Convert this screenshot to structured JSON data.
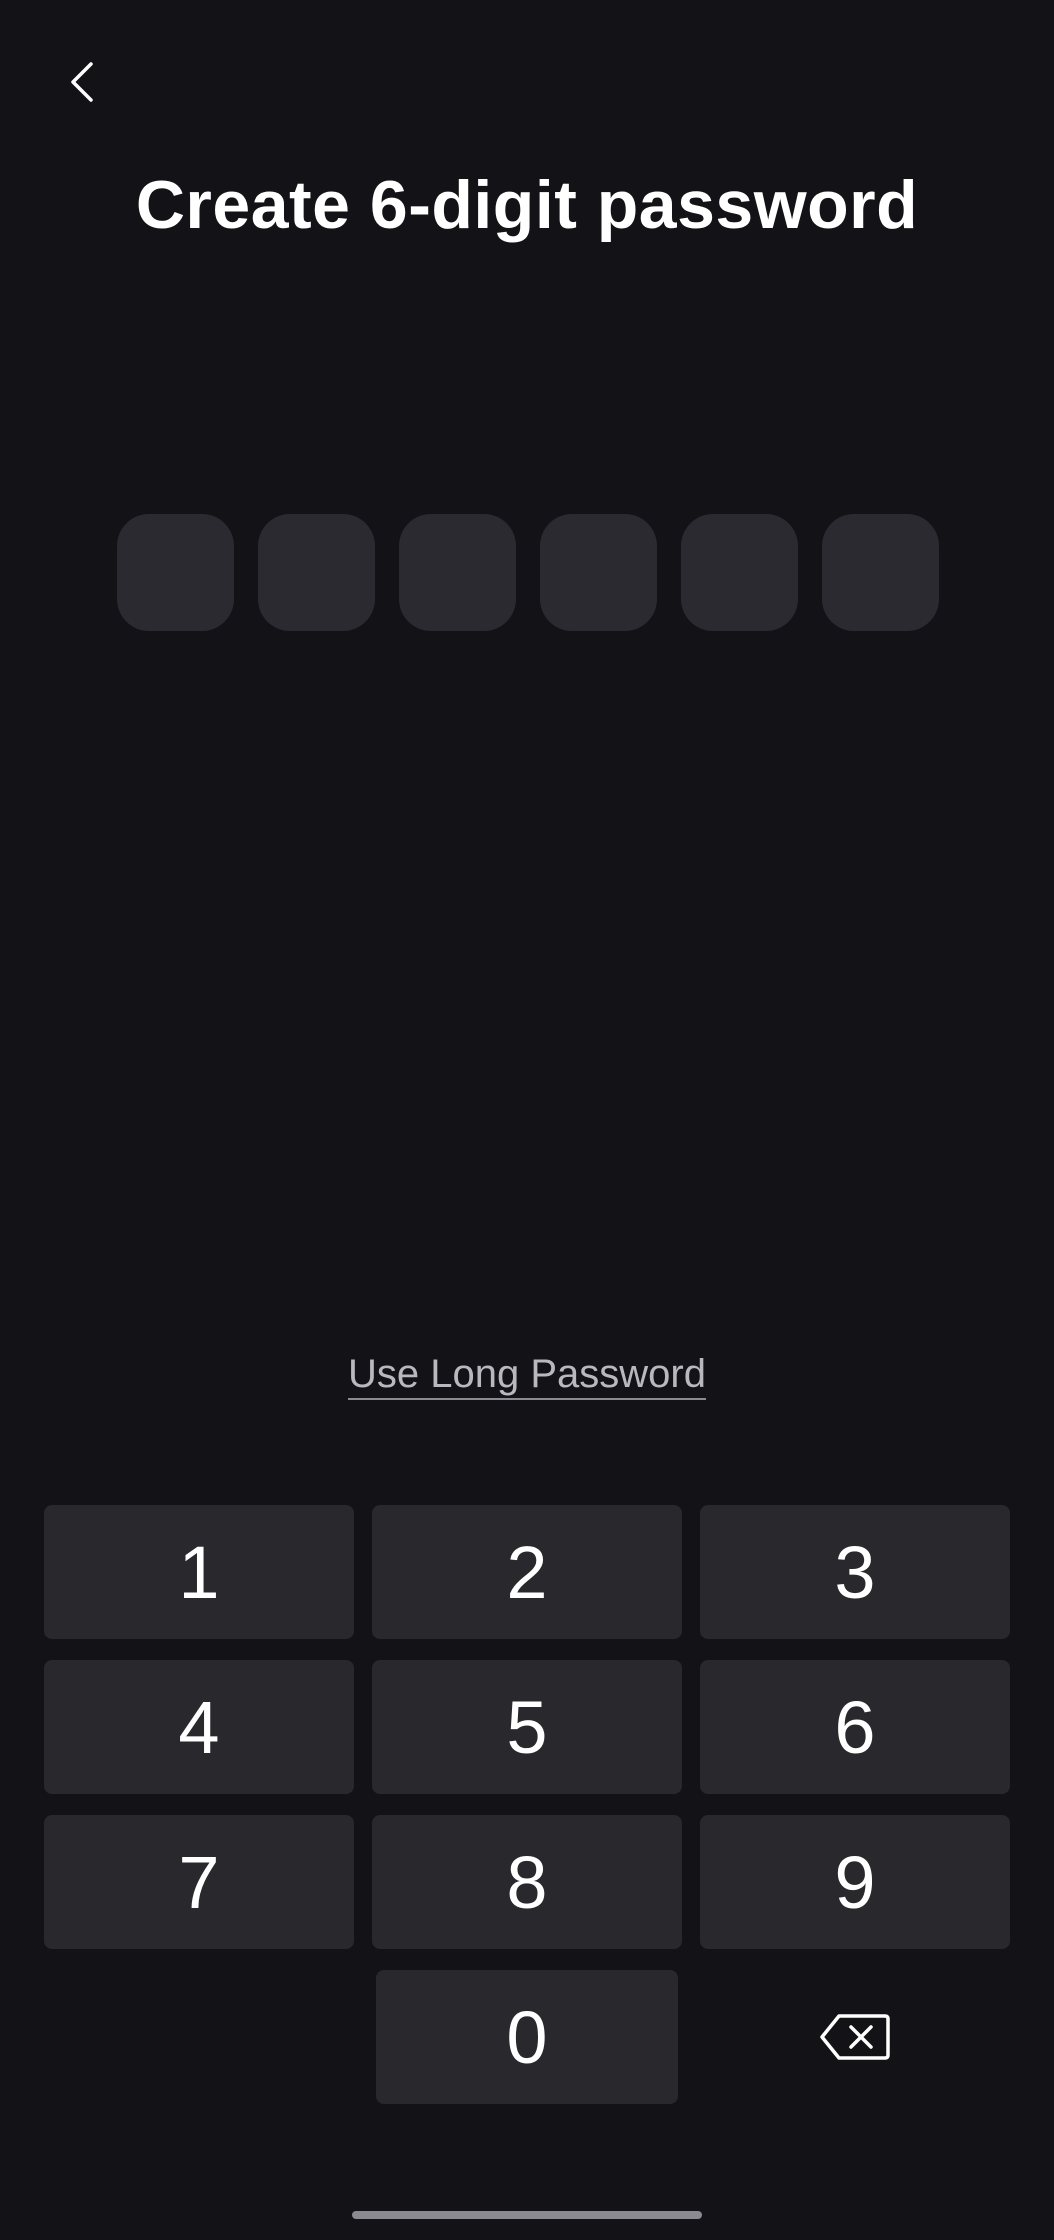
{
  "header": {
    "back_icon": "chevron-left-icon",
    "title": "Create 6-digit password"
  },
  "pin": {
    "length": 6,
    "filled": 0
  },
  "long_password_link": "Use Long Password",
  "keypad": {
    "keys": [
      "1",
      "2",
      "3",
      "4",
      "5",
      "6",
      "7",
      "8",
      "9",
      "0"
    ],
    "delete_icon": "backspace-icon"
  },
  "colors": {
    "background": "#131317",
    "cell": "#2a2a30",
    "key": "#28282d",
    "link": "#b8b8be"
  }
}
